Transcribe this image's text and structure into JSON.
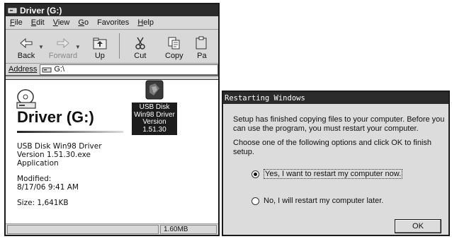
{
  "explorer": {
    "title": "Driver (G:)",
    "menu": [
      "File",
      "Edit",
      "View",
      "Go",
      "Favorites",
      "Help"
    ],
    "toolbar": {
      "back": "Back",
      "forward": "Forward",
      "up": "Up",
      "cut": "Cut",
      "copy": "Copy",
      "paste": "Pa"
    },
    "address_label": "Address",
    "address_value": "G:\\",
    "drive_title": "Driver (G:)",
    "file_info_name": "USB Disk Win98 Driver",
    "file_info_version": "Version 1.51.30.exe",
    "file_info_type": "Application",
    "modified_label": "Modified:",
    "modified_value": "8/17/06 9:41 AM",
    "size": "Size: 1,641KB",
    "file_icon_label": [
      "USB Disk",
      "Win98 Driver",
      "Version",
      "1.51.30"
    ],
    "status_size": "1.60MB"
  },
  "dialog": {
    "title": "Restarting Windows",
    "message1": "Setup has finished copying files to your computer.  Before you can use the program, you must restart your computer.",
    "message2": "Choose one of the following options and click OK to finish setup.",
    "option_yes": "Yes, I want to restart my computer now.",
    "option_no": "No, I will restart my computer later.",
    "ok_label": "OK"
  }
}
